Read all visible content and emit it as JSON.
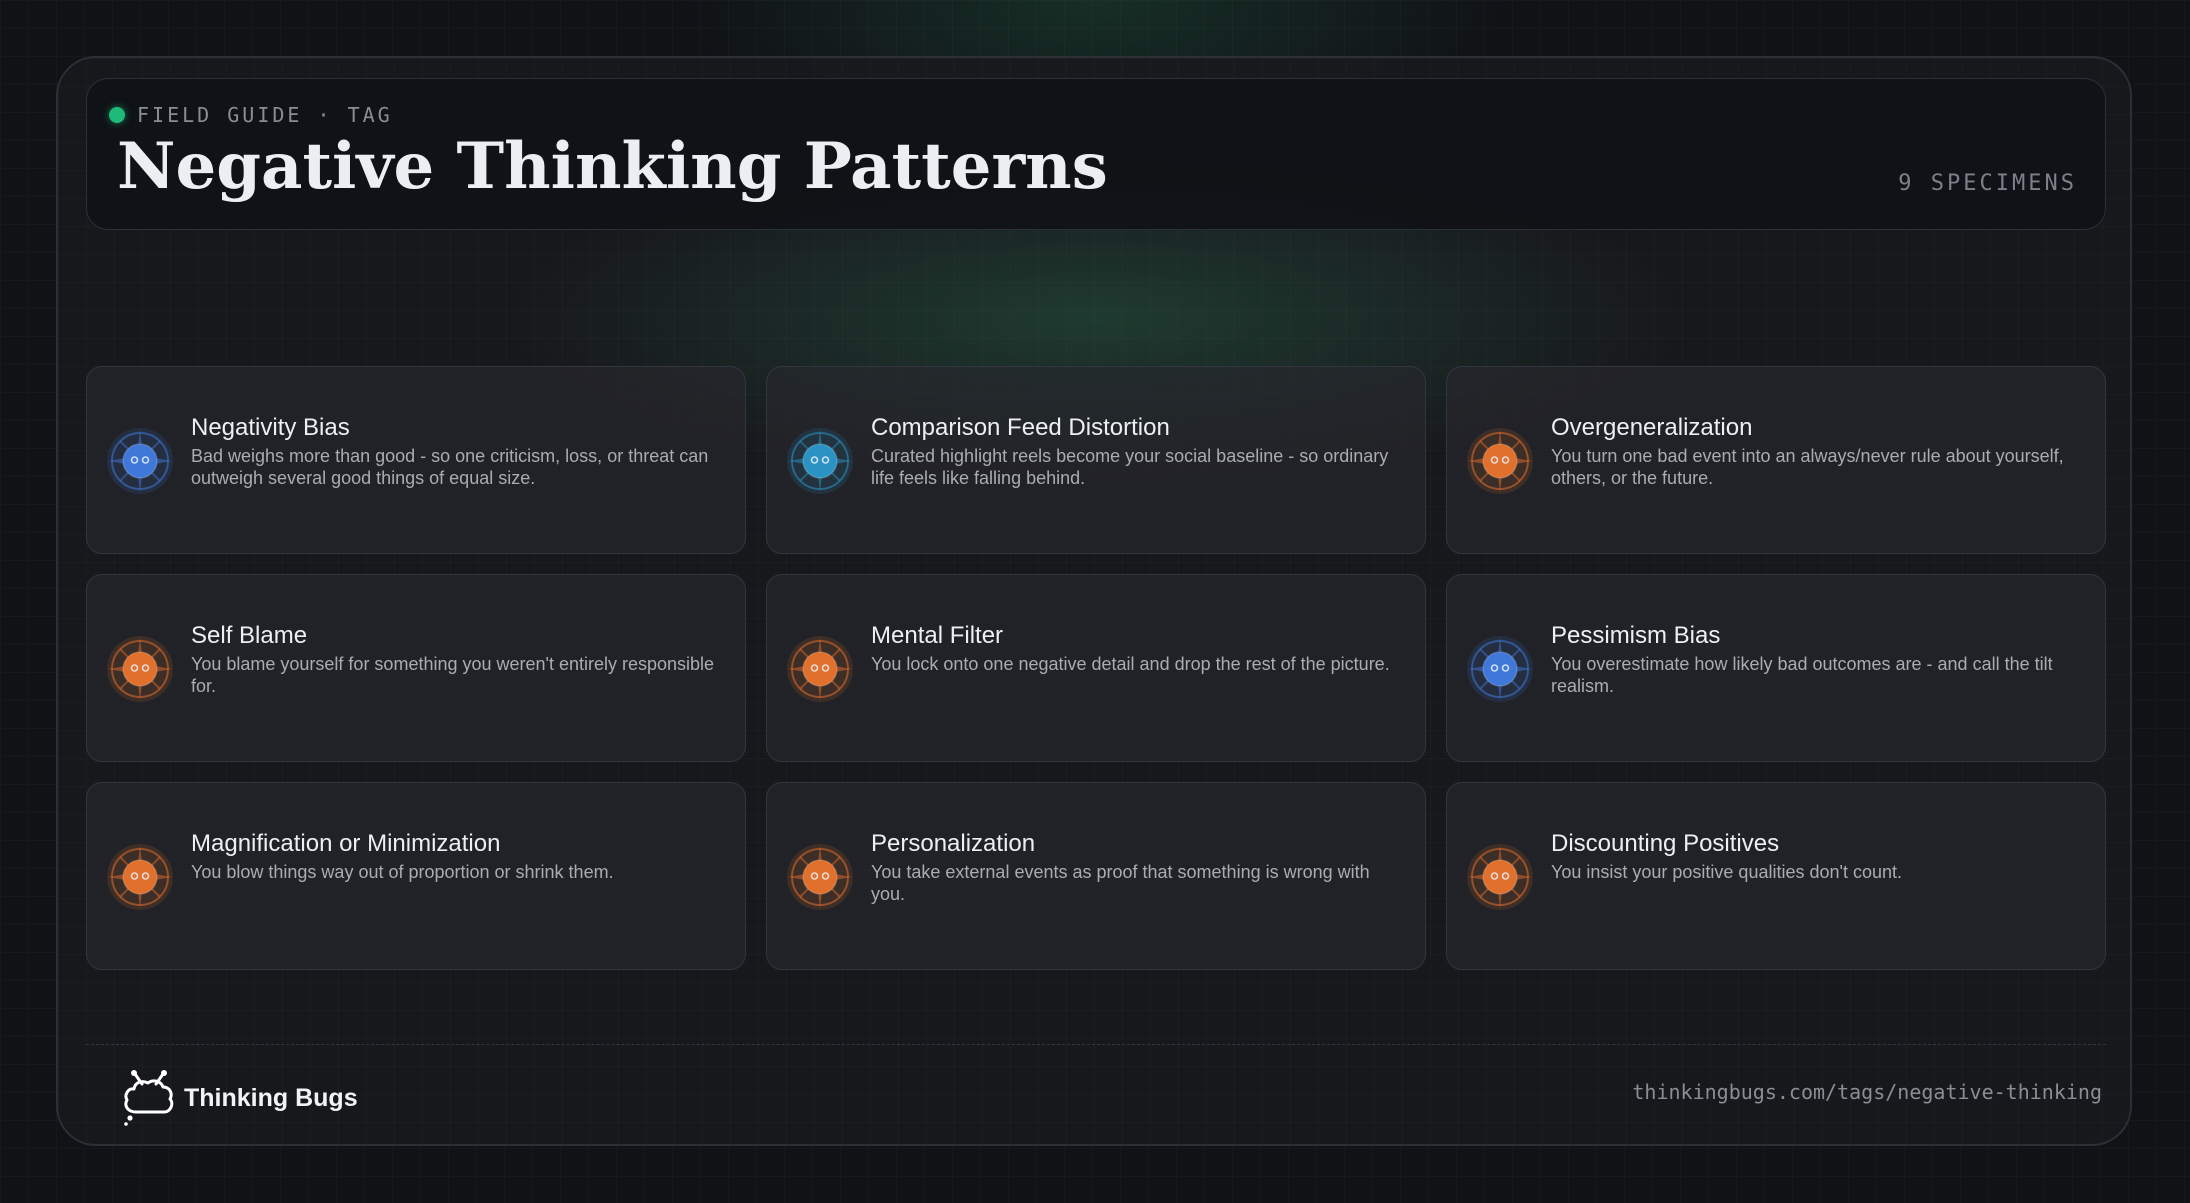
{
  "header": {
    "eyebrow": "FIELD GUIDE · TAG",
    "title": "Negative Thinking Patterns",
    "count": "9 SPECIMENS"
  },
  "patterns": [
    {
      "title": "Negativity Bias",
      "description": "Bad weighs more than good - so one criticism, loss, or threat can outweigh several good things of equal size.",
      "icon": "blue-bug-icon",
      "color": "#3f78d8"
    },
    {
      "title": "Comparison Feed Distortion",
      "description": "Curated highlight reels become your social baseline - so ordinary life feels like falling behind.",
      "icon": "cyan-bug-icon",
      "color": "#2b93c4"
    },
    {
      "title": "Overgeneralization",
      "description": "You turn one bad event into an always/never rule about yourself, others, or the future.",
      "icon": "orange-bug-icon",
      "color": "#e0702b"
    },
    {
      "title": "Self Blame",
      "description": "You blame yourself for something you weren't entirely responsible for.",
      "icon": "orange-bug-icon",
      "color": "#e0702b"
    },
    {
      "title": "Mental Filter",
      "description": "You lock onto one negative detail and drop the rest of the picture.",
      "icon": "orange-bug-icon",
      "color": "#e0702b"
    },
    {
      "title": "Pessimism Bias",
      "description": "You overestimate how likely bad outcomes are - and call the tilt realism.",
      "icon": "blue-bug-icon",
      "color": "#3f78d8"
    },
    {
      "title": "Magnification or Minimization",
      "description": "You blow things way out of proportion or shrink them.",
      "icon": "orange-bug-icon",
      "color": "#e0702b"
    },
    {
      "title": "Personalization",
      "description": "You take external events as proof that something is wrong with you.",
      "icon": "orange-bug-icon",
      "color": "#e0702b"
    },
    {
      "title": "Discounting Positives",
      "description": "You insist your positive qualities don't count.",
      "icon": "orange-bug-icon",
      "color": "#e0702b"
    }
  ],
  "footer": {
    "brand": "Thinking Bugs",
    "logo_icon": "cloud-bug-logo-icon",
    "url": "thinkingbugs.com/tags/negative-thinking"
  },
  "colors": {
    "accent_green": "#1fba7a",
    "background": "#101216"
  }
}
